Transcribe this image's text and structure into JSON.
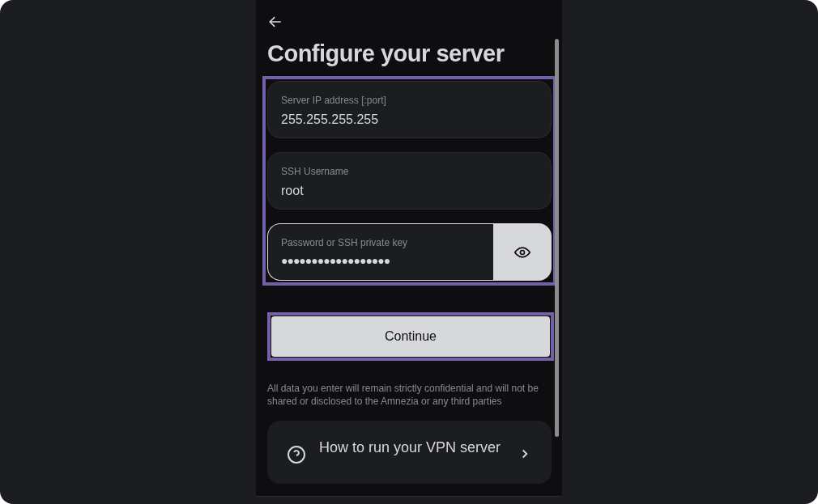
{
  "title": "Configure your server",
  "fields": [
    {
      "kind": "text",
      "label": "Server IP address [:port]",
      "value": "255.255.255.255",
      "focused": false
    },
    {
      "kind": "text",
      "label": "SSH Username",
      "value": "root",
      "focused": false
    },
    {
      "kind": "secret",
      "label": "Password or SSH private key",
      "value": "●●●●●●●●●●●●●●●●●●",
      "focused": true
    }
  ],
  "continue_button": "Continue",
  "disclaimer": "All data you enter will remain strictly confidential and will not be shared or disclosed to the Amnezia or any third parties",
  "help_card": {
    "title": "How to run your VPN server"
  }
}
